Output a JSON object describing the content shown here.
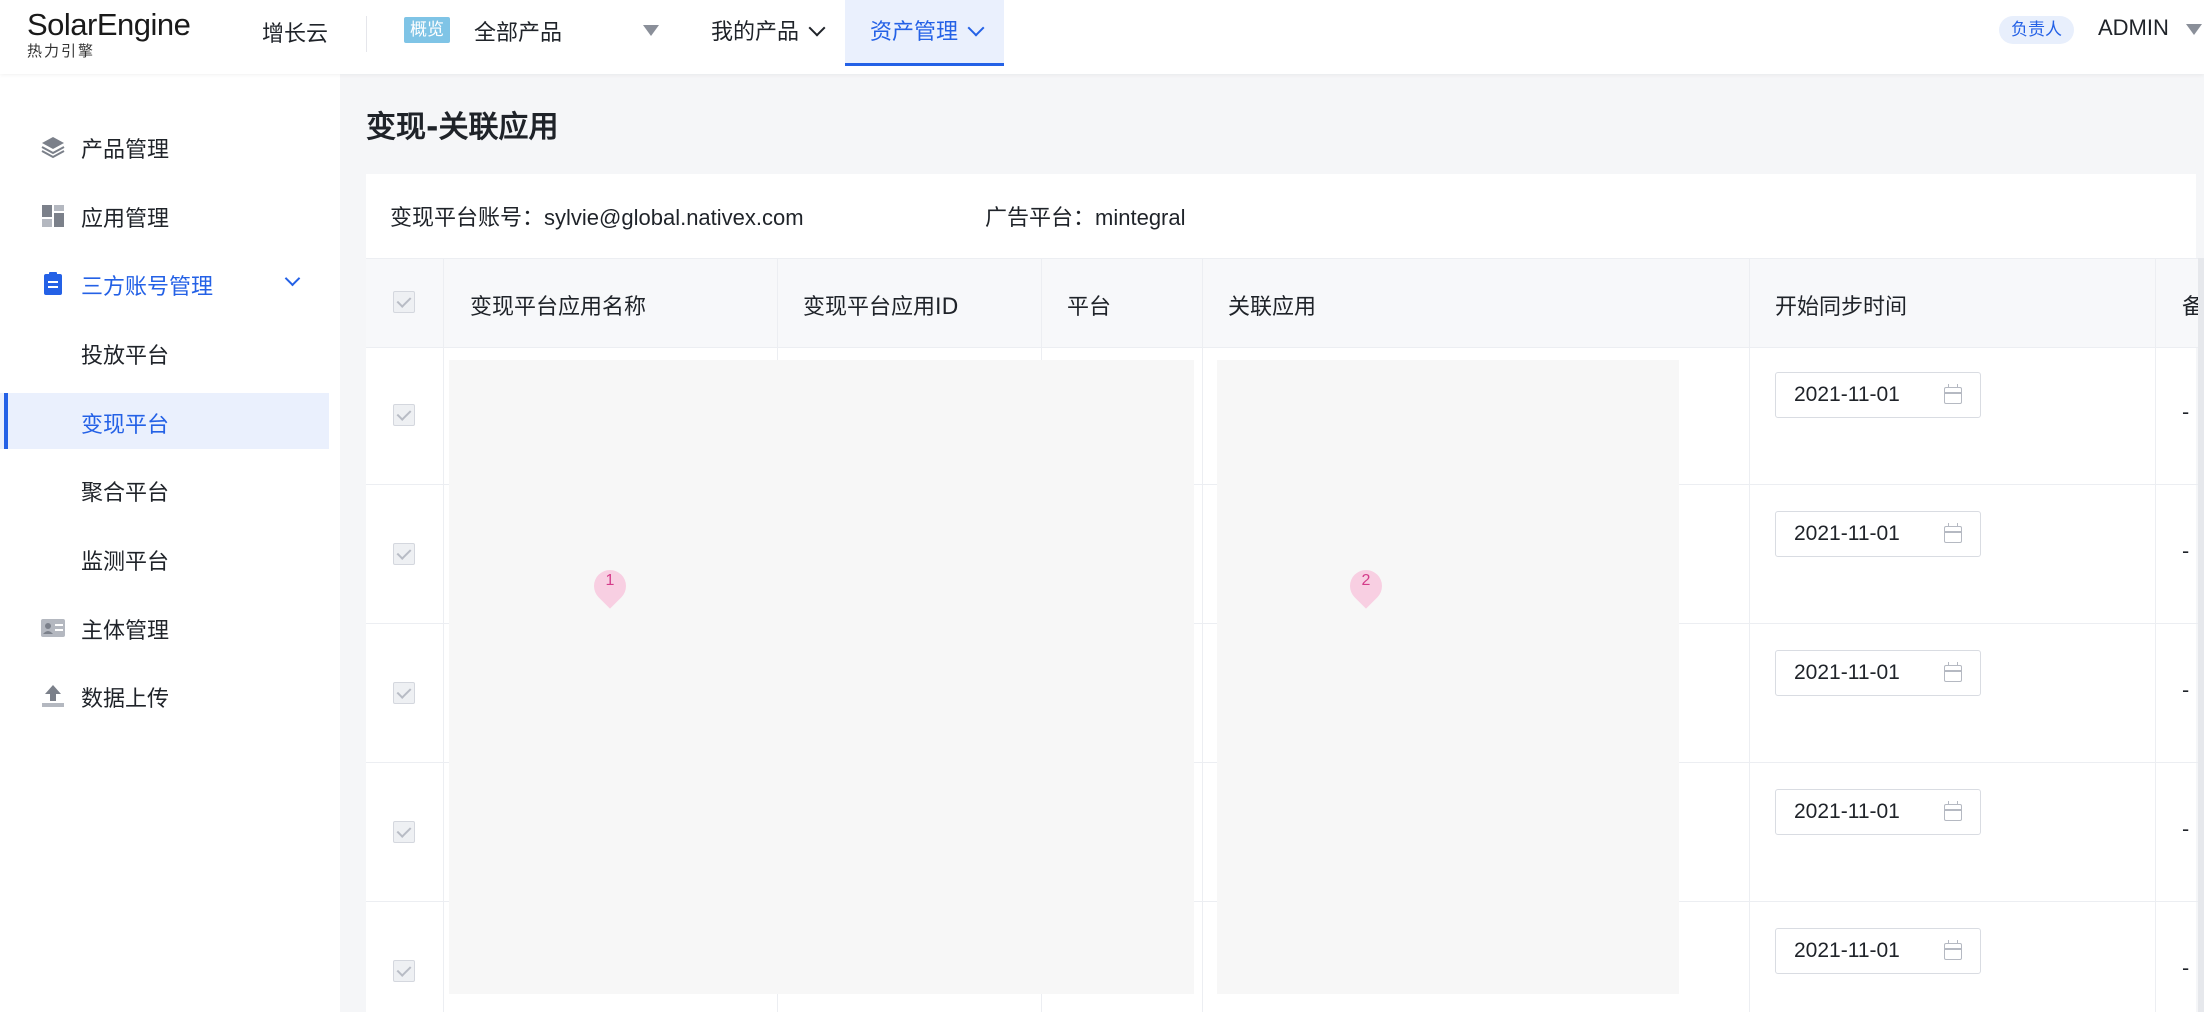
{
  "header": {
    "logo_main": "SolarEngine",
    "logo_sub": "热力引擎",
    "brand2": "增长云",
    "overview_badge": "概览",
    "all_products": "全部产品",
    "nav": [
      {
        "label": "我的产品"
      },
      {
        "label": "资产管理",
        "active": true
      }
    ],
    "role_badge": "负责人",
    "user": "ADMIN"
  },
  "sidebar": {
    "items": [
      {
        "label": "产品管理",
        "icon": "layers-icon"
      },
      {
        "label": "应用管理",
        "icon": "grid-icon"
      },
      {
        "label": "三方账号管理",
        "icon": "clipboard-icon",
        "expanded": true
      },
      {
        "label": "投放平台"
      },
      {
        "label": "变现平台",
        "selected": true
      },
      {
        "label": "聚合平台"
      },
      {
        "label": "监测平台"
      },
      {
        "label": "主体管理",
        "icon": "id-card-icon"
      },
      {
        "label": "数据上传",
        "icon": "upload-icon"
      }
    ]
  },
  "main": {
    "title": "变现-关联应用",
    "account_label": "变现平台账号：",
    "account_value": "sylvie@global.nativex.com",
    "ad_platform_label": "广告平台：",
    "ad_platform_value": "mintegral",
    "table": {
      "columns": [
        "变现平台应用名称",
        "变现平台应用ID",
        "平台",
        "关联应用",
        "开始同步时间",
        "备"
      ],
      "rows": [
        {
          "start_date": "2021-11-01",
          "note": "-"
        },
        {
          "start_date": "2021-11-01",
          "note": "-"
        },
        {
          "start_date": "2021-11-01",
          "note": "-"
        },
        {
          "start_date": "2021-11-01",
          "note": "-"
        },
        {
          "start_date": "2021-11-01",
          "note": "-"
        }
      ]
    },
    "markers": [
      "1",
      "2"
    ]
  },
  "colors": {
    "accent": "#2461e6",
    "selected_bg": "#eaf0fd",
    "overview_badge_bg": "#7fc4e6",
    "marker_pink": "#f8cfe2"
  }
}
